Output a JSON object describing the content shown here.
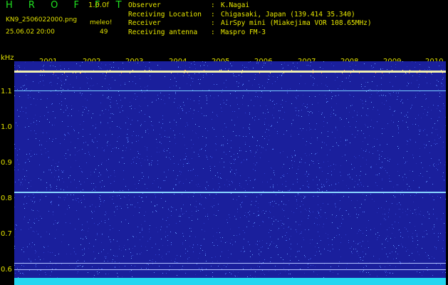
{
  "header": {
    "logo": "H R O F F T",
    "version": "1.0.0f",
    "filename": "KN9_2506022000.png",
    "datetime": "25.06.02 20:00",
    "meteor_label": "meleo!",
    "meteor_count": "49",
    "meta": [
      {
        "key": "Observer",
        "value": "K.Nagai"
      },
      {
        "key": "Receiving Location",
        "value": "Chigasaki, Japan (139.414 35.340)"
      },
      {
        "key": "Receiver",
        "value": "AirSpy mini (Miakejima VOR 108.65MHz)"
      },
      {
        "key": "Receiving antenna",
        "value": "Maspro FM-3"
      }
    ]
  },
  "axis": {
    "unit": "kHz",
    "y_ticks": [
      "1.1",
      "1.0",
      "0.9",
      "0.8",
      "0.7",
      "0.6"
    ],
    "x_ticks": [
      "2001",
      "2002",
      "2003",
      "2004",
      "2005",
      "2006",
      "2007",
      "2008",
      "2009",
      "2010"
    ]
  },
  "colors": {
    "background": "#1a1f9c",
    "carrier": "#e8e8a0",
    "line_mid": "#60c0ff",
    "strip": "#24d6f0",
    "label": "#e0e000"
  }
}
